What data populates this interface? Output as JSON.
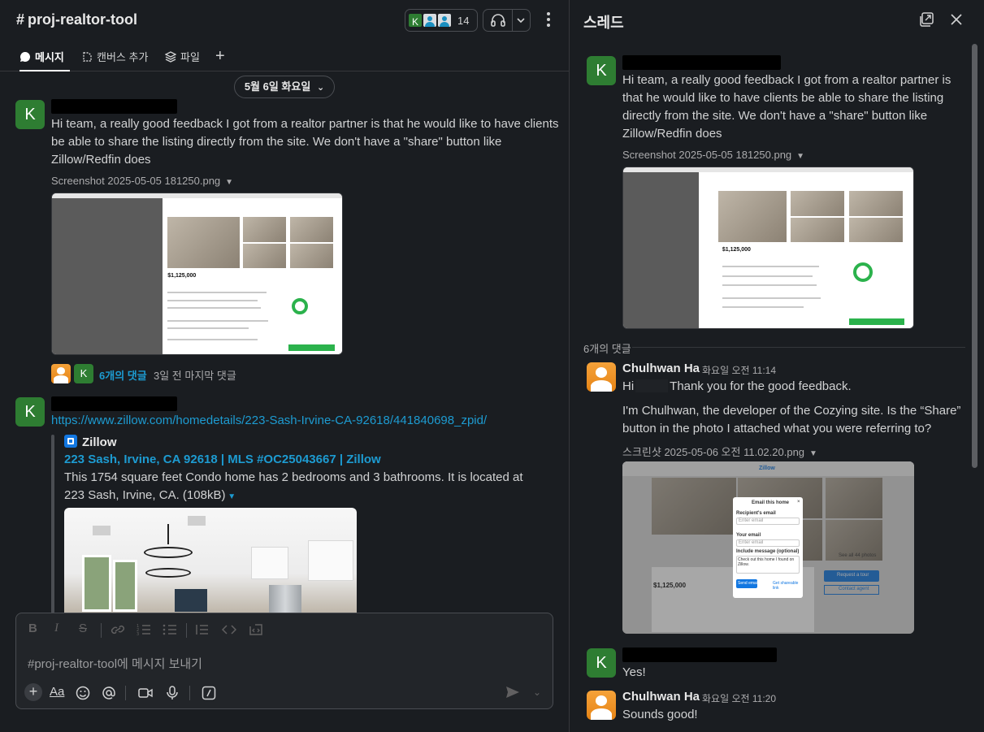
{
  "channel": {
    "hash": "#",
    "name": "proj-realtor-tool",
    "member_initial": "K",
    "member_count": "14",
    "tabs": [
      {
        "label": "메시지"
      },
      {
        "label": "캔버스 추가"
      },
      {
        "label": "파일"
      }
    ],
    "add_tab": "+",
    "date_divider": "5월 6일 화요일",
    "date_caret": "⌄"
  },
  "messages": [
    {
      "avatar_initial": "K",
      "text": "Hi team, a really good feedback I got from a realtor partner is that he would like to have clients be able to share the listing directly from the site. We don't have a \"share\" button like Zillow/Redfin does",
      "file_name": "Screenshot 2025-05-05 181250.png",
      "shot": {
        "price": "$1,125,000"
      },
      "reply_avatar_initial": "K",
      "reply_count": "6개의 댓글",
      "reply_meta": "3일 전 마지막 댓글"
    },
    {
      "avatar_initial": "K",
      "link": "https://www.zillow.com/homedetails/223-Sash-Irvine-CA-92618/441840698_zpid/",
      "unfurl": {
        "site": "Zillow",
        "title": "223 Sash, Irvine, CA 92618 | MLS #OC25043667 | Zillow",
        "desc": "This 1754 square feet Condo home has 2 bedrooms and 3 bathrooms. It is located at 223 Sash, Irvine, CA.",
        "size": "(108kB)"
      }
    }
  ],
  "composer": {
    "format_buttons": [
      "B",
      "I",
      "S"
    ],
    "placeholder": "#proj-realtor-tool에 메시지 보내기",
    "controls": {
      "plus": "+",
      "text_format": "Aa"
    }
  },
  "thread": {
    "title": "스레드",
    "parent": {
      "avatar_initial": "K",
      "text": "Hi team, a really good feedback I got from a realtor partner is that he would like to have clients be able to share the listing directly from the site. We don't have a \"share\" button like Zillow/Redfin does",
      "file_name": "Screenshot 2025-05-05 181250.png",
      "shot": {
        "price": "$1,125,000"
      }
    },
    "reply_count_label": "6개의 댓글",
    "replies": [
      {
        "name": "Chulhwan Ha",
        "time": "화요일 오전 11:14",
        "line1_a": "Hi",
        "line1_b": "Thank you for the good feedback.",
        "line2": "I'm Chulhwan, the developer of the Cozying site. Is the “Share” button in the photo I attached what you were referring to?",
        "file_name": "스크린샷 2025-05-06 오전 11.02.20.png",
        "shot": {
          "brand": "Zillow",
          "modal_title": "Email this home",
          "recipient_label": "Recipient's email",
          "recipient_placeholder": "Enter email",
          "your_email_label": "Your email",
          "your_email_placeholder": "Enter email",
          "message_label": "Include message (optional)",
          "message_value": "Check out this home I found on Zillow.",
          "send_button": "Send email",
          "link_text": "Get shareable link",
          "price": "$1,125,000",
          "see_photos": "See all 44 photos",
          "request_tour": "Request a tour",
          "contact_agent": "Contact agent"
        }
      },
      {
        "avatar_initial": "K",
        "text": "Yes!"
      },
      {
        "name": "Chulhwan Ha",
        "time": "화요일 오전 11:20",
        "text": "Sounds good!"
      }
    ]
  },
  "colors": {
    "accent_link": "#1d9bd1",
    "avatar_green": "#2e7d32",
    "avatar_orange": "#f5a23a"
  }
}
